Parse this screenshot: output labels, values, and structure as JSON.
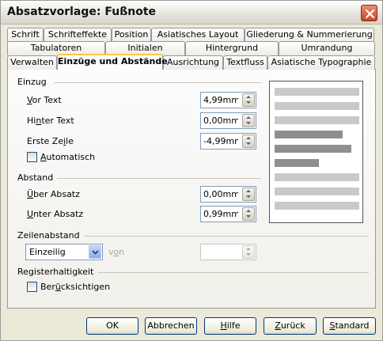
{
  "window": {
    "title": "Absatzvorlage: Fußnote",
    "close_icon": "close-icon"
  },
  "tabs": {
    "row1": [
      {
        "label": "Schrift"
      },
      {
        "label": "Schrifteffekte"
      },
      {
        "label": "Position"
      },
      {
        "label": "Asiatisches Layout"
      },
      {
        "label": "Gliederung & Nummerierung"
      }
    ],
    "row2": [
      {
        "label": "Tabulatoren"
      },
      {
        "label": "Initialen"
      },
      {
        "label": "Hintergrund"
      },
      {
        "label": "Umrandung"
      }
    ],
    "row3": [
      {
        "label": "Verwalten"
      },
      {
        "label": "Einzüge und Abstände",
        "active": true
      },
      {
        "label": "Ausrichtung"
      },
      {
        "label": "Textfluss"
      },
      {
        "label": "Asiatische Typographie"
      }
    ]
  },
  "einzug": {
    "title": "Einzug",
    "vor_text": {
      "label_u": "V",
      "label_rest": "or Text",
      "value": "4,99mm"
    },
    "hinter_text": {
      "label_pre": "Hi",
      "label_u": "n",
      "label_rest": "ter Text",
      "value": "0,00mm"
    },
    "erste_zeile": {
      "label_pre": "Erste Ze",
      "label_u": "i",
      "label_rest": "le",
      "value": "-4,99mm"
    },
    "automatisch": {
      "label_u": "A",
      "label_rest": "utomatisch",
      "checked": false
    }
  },
  "abstand": {
    "title": "Abstand",
    "ueber": {
      "label_u": "Ü",
      "label_rest": "ber Absatz",
      "value": "0,00mm"
    },
    "unter": {
      "label_u": "U",
      "label_rest": "nter Absatz",
      "value": "0,99mm"
    }
  },
  "zeilenabstand": {
    "title": "Zeilenabstand",
    "selected": "Einzeilig",
    "von_pre": "v",
    "von_u": "o",
    "von_rest": "n",
    "von_value": ""
  },
  "registerhaltigkeit": {
    "title": "Registerhaltigkeit",
    "checkbox_pre": "Ber",
    "checkbox_u": "ü",
    "checkbox_rest": "cksichtigen",
    "checked": false
  },
  "buttons": {
    "ok": "OK",
    "abbrechen": "Abbrechen",
    "hilfe_u": "H",
    "hilfe_rest": "ilfe",
    "zurueck_u": "Z",
    "zurueck_rest": "urück",
    "standard_u": "S",
    "standard_rest": "tandard"
  },
  "colors": {
    "active_tab_accent": "#ffc83c",
    "dialog_bg": "#ece9d8"
  }
}
